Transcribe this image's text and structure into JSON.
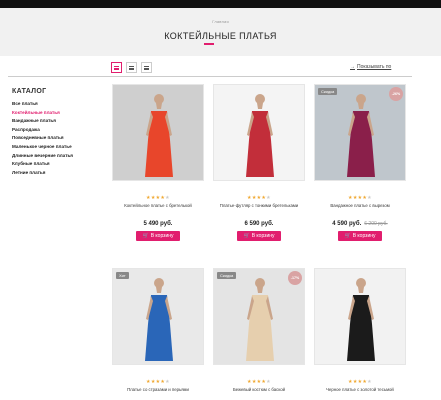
{
  "header": {
    "breadcrumb": "Главная",
    "title": "КОКТЕЙЛЬНЫЕ ПЛАТЬЯ"
  },
  "toolbar": {
    "sort_label": "Показывать по"
  },
  "sidebar": {
    "title": "КАТАЛОГ",
    "items": [
      {
        "label": "Все платья"
      },
      {
        "label": "Коктейльные платья"
      },
      {
        "label": "Вандажные платья"
      },
      {
        "label": "Распродажа"
      },
      {
        "label": "Повседневные платья"
      },
      {
        "label": "Маленькое черное платье"
      },
      {
        "label": "Длинные вечерние платья"
      },
      {
        "label": "Клубные платья"
      },
      {
        "label": "Летние платья"
      }
    ]
  },
  "products": [
    {
      "name": "Коктейльное платье с бретелькой",
      "price": "5 490 руб.",
      "old_price": "",
      "badge": "",
      "discount": "",
      "button": "В корзину",
      "stars": 4,
      "dress_color": "#e8462b",
      "bg": "#cfcfcf"
    },
    {
      "name": "Платье-футляр с тонкими бретельками",
      "price": "6 590 руб.",
      "old_price": "",
      "badge": "",
      "discount": "",
      "button": "В корзину",
      "stars": 4,
      "dress_color": "#c22e3a",
      "bg": "#f4f4f4"
    },
    {
      "name": "Вандажное платье с вырезом",
      "price": "4 590 руб.",
      "old_price": "6 200 руб.",
      "badge": "Скидка",
      "discount": "-26%",
      "button": "В корзину",
      "stars": 4,
      "dress_color": "#8a1f4a",
      "bg": "#bfc6cc"
    },
    {
      "name": "Платье со стразами и перьями",
      "price": "",
      "old_price": "",
      "badge": "Хит",
      "discount": "",
      "button": "",
      "stars": 4,
      "dress_color": "#2a66b8",
      "bg": "#e9e9e9"
    },
    {
      "name": "Бежевый костюм с баской",
      "price": "",
      "old_price": "",
      "badge": "Скидка",
      "discount": "-17%",
      "button": "",
      "stars": 4,
      "dress_color": "#e6cfae",
      "bg": "#e4e4e4"
    },
    {
      "name": "Черное платье с золотой тесьмой",
      "price": "",
      "old_price": "",
      "badge": "",
      "discount": "",
      "button": "",
      "stars": 4,
      "dress_color": "#1b1b1b",
      "bg": "#f2f2f2"
    }
  ]
}
